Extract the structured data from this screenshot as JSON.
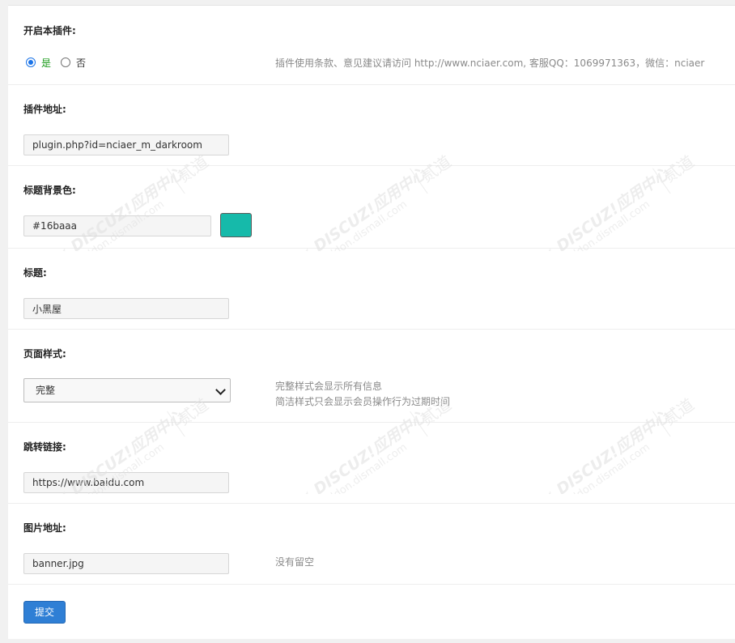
{
  "form": {
    "enable": {
      "label": "开启本插件:",
      "yes": "是",
      "no": "否",
      "selected": "是",
      "hint": "插件使用条款、意见建议请访问 http://www.nciaer.com, 客服QQ：1069971363，微信：nciaer"
    },
    "plugin_url": {
      "label": "插件地址:",
      "value": "plugin.php?id=nciaer_m_darkroom"
    },
    "title_bg": {
      "label": "标题背景色:",
      "value": "#16baaa",
      "swatch_color": "#16baaa"
    },
    "title": {
      "label": "标题:",
      "value": "小黑屋"
    },
    "page_style": {
      "label": "页面样式:",
      "selected": "完整",
      "hint_line1": "完整样式会显示所有信息",
      "hint_line2": "简洁样式只会显示会员操作行为过期时间"
    },
    "jump_link": {
      "label": "跳转链接:",
      "value": "https://www.baidu.com"
    },
    "image_url": {
      "label": "图片地址:",
      "value": "banner.jpg",
      "hint": "没有留空"
    },
    "submit_label": "提交"
  },
  "watermark": {
    "brand": "DISCUZ!应用中心",
    "site": "addon.dismall.com",
    "tag": "贰道"
  },
  "colors": {
    "accent": "#2f7fd5",
    "radio_checked": "#1a73e8",
    "yes_label": "#1b9b1b"
  }
}
